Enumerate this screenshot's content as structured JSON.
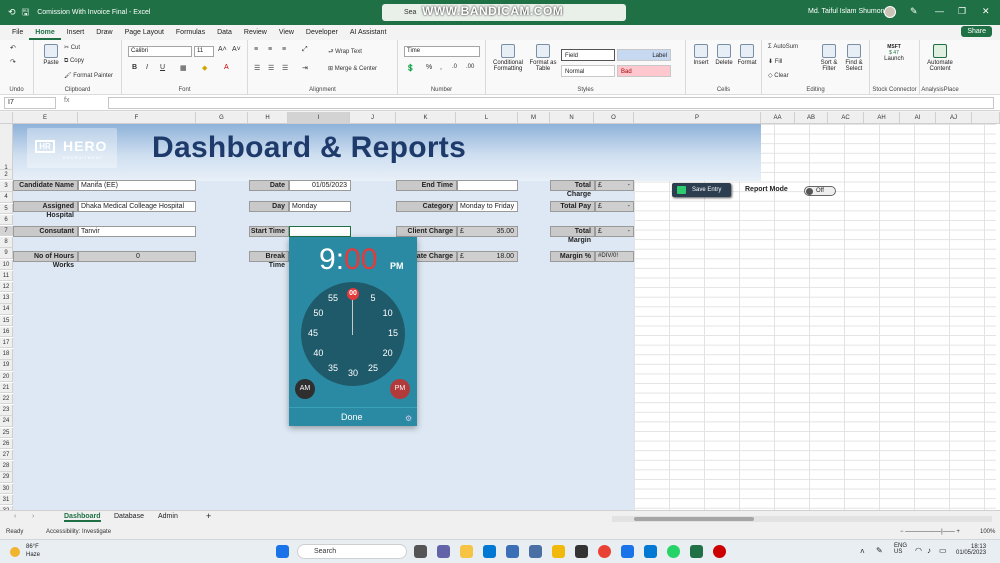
{
  "titlebar": {
    "doc_title": "Comission With Invoice Final  -  Excel",
    "search_placeholder": "Sea",
    "watermark": "WWW.BANDICAM.COM",
    "user": "Md. Taiful Islam Shumon"
  },
  "menu": {
    "tabs": [
      "File",
      "Home",
      "Insert",
      "Draw",
      "Page Layout",
      "Formulas",
      "Data",
      "Review",
      "View",
      "Developer",
      "AI Assistant"
    ],
    "active": "Home",
    "share": "Share"
  },
  "ribbon": {
    "undo": {
      "label": "Undo"
    },
    "clipboard": {
      "label": "Clipboard",
      "paste": "Paste",
      "cut": "Cut",
      "copy": "Copy",
      "format_painter": "Format Painter"
    },
    "font": {
      "label": "Font",
      "name": "Calibri",
      "size": "11",
      "bold": "B",
      "italic": "I",
      "underline": "U"
    },
    "alignment": {
      "label": "Alignment",
      "wrap_text": "Wrap Text",
      "merge_center": "Merge & Center"
    },
    "number": {
      "label": "Number",
      "format": "Time"
    },
    "styles": {
      "label": "Styles",
      "conditional": "Conditional Formatting",
      "format_table": "Format as Table",
      "field": "Field",
      "label_style": "Label",
      "normal": "Normal",
      "bad": "Bad"
    },
    "cells": {
      "label": "Cells",
      "insert": "Insert",
      "delete": "Delete",
      "format": "Format"
    },
    "editing": {
      "label": "Editing",
      "autosum": "AutoSum",
      "fill": "Fill",
      "clear": "Clear",
      "sort_filter": "Sort & Filter",
      "find_select": "Find & Select"
    },
    "stock": {
      "label": "Stock Connector",
      "msft": "MSFT",
      "price": "$ 47",
      "launch": "Launch"
    },
    "analysis": {
      "label": "AnalysisPlace",
      "automate": "Automate Content"
    }
  },
  "formula_bar": {
    "name_box": "I7",
    "fx": "fx",
    "formula": ""
  },
  "columns": [
    "E",
    "F",
    "G",
    "H",
    "I",
    "J",
    "K",
    "L",
    "M",
    "N",
    "O",
    "P",
    "AA",
    "AB",
    "AC",
    "AH",
    "AI",
    "AJ"
  ],
  "rows": [
    "1",
    "2",
    "3",
    "4",
    "5",
    "6",
    "7",
    "8",
    "9",
    "10",
    "11",
    "12",
    "13",
    "14",
    "15",
    "16",
    "17",
    "18",
    "19",
    "20",
    "21",
    "22",
    "23",
    "24",
    "25",
    "26",
    "27",
    "28",
    "29",
    "30",
    "31",
    "32",
    "33"
  ],
  "dashboard": {
    "logo_text": "HERO",
    "logo_mark": "HR",
    "logo_sub": "RECRUITMENT",
    "title": "Dashboard & Reports",
    "fields": {
      "candidate_name": {
        "label": "Candidate Name",
        "value": "Manifa (EE)"
      },
      "assigned_hospital": {
        "label": "Assigned Hospital",
        "value": "Dhaka Medical Colleage Hospital"
      },
      "consultant": {
        "label": "Consutant",
        "value": "Tanvir"
      },
      "hours_worked": {
        "label": "No of Hours Works",
        "value": "0"
      },
      "date": {
        "label": "Date",
        "value": "01/05/2023"
      },
      "day": {
        "label": "Day",
        "value": "Monday"
      },
      "start_time": {
        "label": "Start Time",
        "value": ""
      },
      "break_time": {
        "label": "Break Time",
        "value": ""
      },
      "end_time": {
        "label": "End Time",
        "value": ""
      },
      "category": {
        "label": "Category",
        "value": "Monday to Friday"
      },
      "client_charge": {
        "label": "Client Charge",
        "currency": "£",
        "value": "35.00"
      },
      "candidate_charge": {
        "label": "date Charge",
        "currency": "£",
        "value": "18.00"
      },
      "total_charge": {
        "label": "Total Charge",
        "currency": "£",
        "value": "-"
      },
      "total_pay": {
        "label": "Total Pay",
        "currency": "£",
        "value": "-"
      },
      "total_margin": {
        "label": "Total Margin",
        "currency": "£",
        "value": "-"
      },
      "margin_pct": {
        "label": "Margin %",
        "value": "#DIV/0!"
      }
    },
    "save_entry": "Save Entry",
    "report_mode": "Report Mode",
    "toggle_state": "Off"
  },
  "time_picker": {
    "hour": "9",
    "separator": ":",
    "minutes": "00",
    "period": "PM",
    "ticks": [
      "00",
      "5",
      "10",
      "15",
      "20",
      "25",
      "30",
      "35",
      "40",
      "45",
      "50",
      "55"
    ],
    "am": "AM",
    "pm": "PM",
    "done": "Done"
  },
  "sheets": {
    "tabs": [
      "Dashboard",
      "Database",
      "Admin"
    ],
    "active": "Dashboard",
    "add": "+"
  },
  "status": {
    "ready": "Ready",
    "accessibility": "Accessibility: Investigate",
    "zoom": "100%"
  },
  "taskbar": {
    "temp": "86°F",
    "weather": "Haze",
    "search": "Search",
    "lang1": "ENG",
    "lang2": "US",
    "time": "18:13",
    "date": "01/05/2023"
  },
  "colors": {
    "excel_green": "#1f7145",
    "picker_bg": "#2b8aa3",
    "picker_accent": "#e23b3b",
    "title_blue": "#1e3a6b"
  }
}
